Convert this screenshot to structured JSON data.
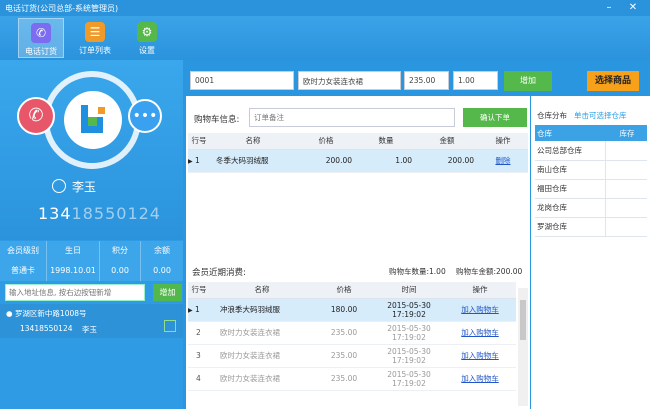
{
  "window": {
    "title": "电话订货(公司总部-系统管理员)"
  },
  "toolbar": [
    {
      "label": "电话订货",
      "icon": "phone-icon",
      "color": "#7b6cf0"
    },
    {
      "label": "订单列表",
      "icon": "list-icon",
      "color": "#f09a2a"
    },
    {
      "label": "设置",
      "icon": "gear-icon",
      "color": "#56b84a"
    }
  ],
  "customer": {
    "name": "李玉",
    "phone_visible": "134",
    "phone_blur": "18550124",
    "member": {
      "headers": [
        "会员级别",
        "生日",
        "积分",
        "余额"
      ],
      "values": [
        "普通卡",
        "1998.10.01",
        "0.00",
        "0.00"
      ]
    },
    "address_placeholder": "输入地址信息, 按右边按钮新增",
    "address_add_label": "增加",
    "address_line": "罗湖区新中路1008号",
    "address_phone": "13418550124",
    "address_name": "李玉"
  },
  "product_entry": {
    "code": "0001",
    "name": "欧时力女装连衣裙",
    "price": "235.00",
    "qty": "1.00",
    "add_label": "增加",
    "choose_label": "选择商品"
  },
  "cart": {
    "label": "购物车信息:",
    "note_placeholder": "订单备注",
    "confirm_label": "确认下单",
    "headers": [
      "行号",
      "名称",
      "价格",
      "数量",
      "金额",
      "操作"
    ],
    "rows": [
      {
        "no": "1",
        "name": "冬季大码羽绒服",
        "price": "200.00",
        "qty": "1.00",
        "amount": "200.00",
        "action": "删除"
      }
    ]
  },
  "recent": {
    "label": "会员近期消费:",
    "cart_count": "购物车数量:1.00",
    "cart_amount": "购物车金额:200.00",
    "headers": [
      "行号",
      "名称",
      "价格",
      "时间",
      "操作"
    ],
    "rows": [
      {
        "no": "1",
        "name": "冲浪季大码羽绒服",
        "price": "180.00",
        "date": "2015-05-30",
        "time": "17:19:02",
        "action": "加入购物车"
      },
      {
        "no": "2",
        "name": "欧时力女装连衣裙",
        "price": "235.00",
        "date": "2015-05-30",
        "time": "17:19:02",
        "action": "加入购物车"
      },
      {
        "no": "3",
        "name": "欧时力女装连衣裙",
        "price": "235.00",
        "date": "2015-05-30",
        "time": "17:19:02",
        "action": "加入购物车"
      },
      {
        "no": "4",
        "name": "欧时力女装连衣裙",
        "price": "235.00",
        "date": "2015-05-30",
        "time": "17:19:02",
        "action": "加入购物车"
      }
    ]
  },
  "warehouse": {
    "label": "仓库分布",
    "hint": "单击可选择仓库",
    "headers": [
      "仓库",
      "库存"
    ],
    "rows": [
      {
        "name": "公司总部仓库",
        "stock": ""
      },
      {
        "name": "南山仓库",
        "stock": ""
      },
      {
        "name": "福田仓库",
        "stock": ""
      },
      {
        "name": "龙岗仓库",
        "stock": ""
      },
      {
        "name": "罗湖仓库",
        "stock": ""
      }
    ]
  }
}
